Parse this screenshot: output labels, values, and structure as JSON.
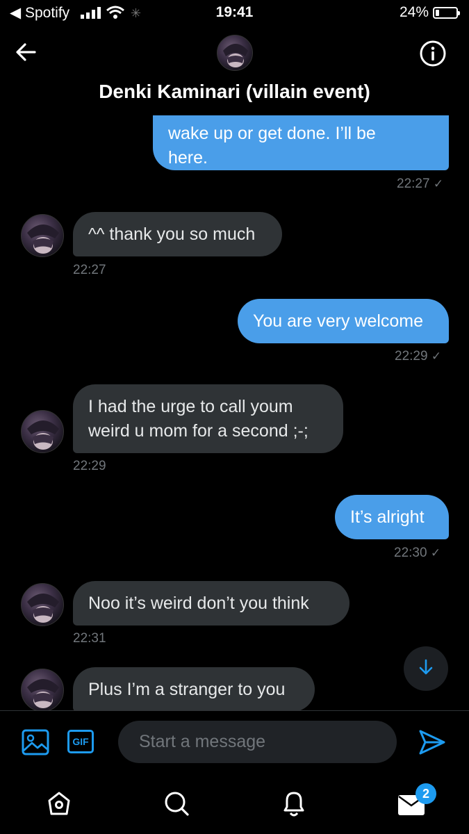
{
  "status_bar": {
    "carrier_back": "◀ Spotify",
    "time": "19:41",
    "battery": "24%",
    "battery_level": 0.24
  },
  "header": {
    "title": "Denki Kaminari (villain event)"
  },
  "messages": [
    {
      "direction": "out",
      "text_lines": [
        "wake up or get done. I’ll be",
        "here."
      ],
      "time": "22:27",
      "check": "✓"
    },
    {
      "direction": "in",
      "text": "^^ thank you so much",
      "time": "22:27"
    },
    {
      "direction": "out",
      "text": "You are very welcome",
      "time": "22:29",
      "check": "✓"
    },
    {
      "direction": "in",
      "text_lines": [
        "I had the urge to call  youm",
        "weird u mom for a second ;-;"
      ],
      "time": "22:29"
    },
    {
      "direction": "out",
      "text": "It’s alright",
      "time": "22:30",
      "check": "✓"
    },
    {
      "direction": "in",
      "text": "Noo it’s weird don’t you think",
      "time": "22:31"
    },
    {
      "direction": "in",
      "text": "Plus I’m a stranger to you"
    }
  ],
  "composer": {
    "placeholder": "Start a message",
    "gif_label": "GIF"
  },
  "nav": {
    "messages_badge": "2"
  },
  "colors": {
    "accent": "#1d9bf0",
    "outgoing_bubble": "#4a9ee9",
    "incoming_bubble": "#2f3336"
  }
}
